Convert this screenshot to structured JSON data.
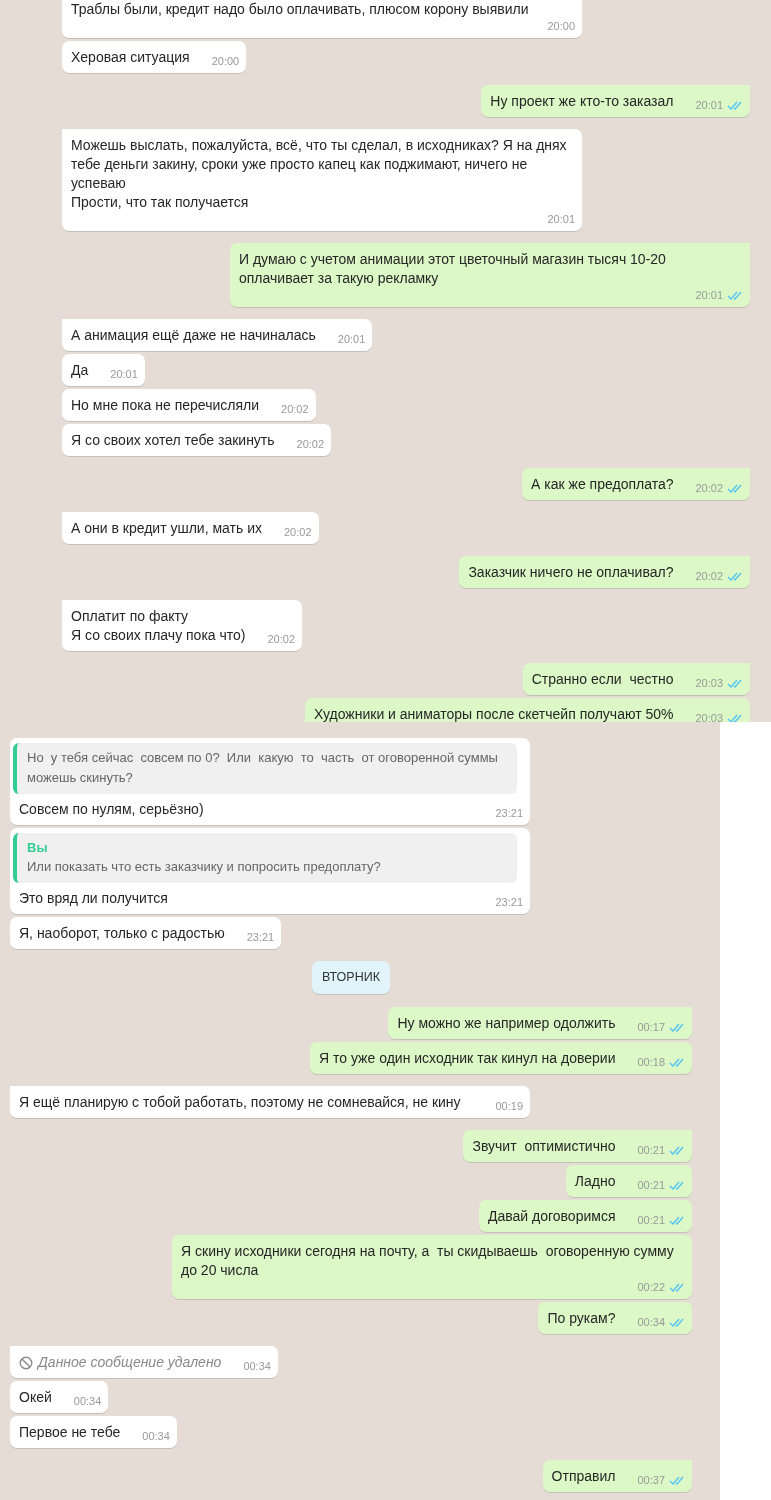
{
  "panels": [
    {
      "messages": [
        {
          "kind": "incoming",
          "text": "Траблы были, кредит надо было оплачивать, плюсом корону выявили",
          "time": "20:00",
          "tail": false
        },
        {
          "kind": "incoming",
          "text": "Херовая ситуация",
          "time": "20:00",
          "tail": false
        },
        {
          "kind": "outgoing",
          "text": "Ну проект же кто-то заказал",
          "time": "20:01",
          "read": true,
          "tail": true
        },
        {
          "kind": "incoming",
          "text": "Можешь выслать, пожалуйста, всё, что ты сделал, в исходниках? Я на днях тебе деньги закину, сроки уже просто капец как поджимают, ничего не успеваю\nПрости, что так получается",
          "time": "20:01",
          "tail": true
        },
        {
          "kind": "outgoing",
          "text": "И думаю с учетом анимации этот цветочный магазин тысяч 10-20 оплачивает за такую рекламку",
          "time": "20:01",
          "read": true,
          "tail": true
        },
        {
          "kind": "incoming",
          "text": "А анимация ещё даже не начиналась",
          "time": "20:01",
          "tail": true
        },
        {
          "kind": "incoming",
          "text": "Да",
          "time": "20:01",
          "tail": false
        },
        {
          "kind": "incoming",
          "text": "Но мне пока не перечисляли",
          "time": "20:02",
          "tail": false
        },
        {
          "kind": "incoming",
          "text": "Я со своих хотел тебе закинуть",
          "time": "20:02",
          "tail": false
        },
        {
          "kind": "outgoing",
          "text": "А как же предоплата?",
          "time": "20:02",
          "read": true,
          "tail": true
        },
        {
          "kind": "incoming",
          "text": "А они в кредит ушли, мать их",
          "time": "20:02",
          "tail": true
        },
        {
          "kind": "outgoing",
          "text": "Заказчик ничего не оплачивал?",
          "time": "20:02",
          "read": true,
          "tail": true
        },
        {
          "kind": "incoming",
          "text": "Оплатит по факту\nЯ со своих плачу пока что)",
          "time": "20:02",
          "tail": true
        },
        {
          "kind": "outgoing",
          "text": "Странно если  честно",
          "time": "20:03",
          "read": true,
          "tail": true
        },
        {
          "kind": "outgoing",
          "text": "Художники и аниматоры после скетчейп получают 50%",
          "time": "20:03",
          "read": true,
          "tail": false
        }
      ]
    },
    {
      "messages": [
        {
          "kind": "incoming",
          "quote": {
            "text": "Но  у тебя сейчас  совсем по 0?  Или  какую  то  часть  от оговоренной суммы можешь скинуть?"
          },
          "text": "Совсем по нулям, серьёзно)",
          "time": "23:21",
          "tail": false
        },
        {
          "kind": "incoming",
          "quote": {
            "author": "Вы",
            "text": "Или показать что есть заказчику и попросить предоплату?"
          },
          "text": "Это вряд ли получится",
          "time": "23:21",
          "tail": false
        },
        {
          "kind": "incoming",
          "text": "Я, наоборот, только с радостью",
          "time": "23:21",
          "tail": false
        },
        {
          "kind": "day",
          "text": "ВТОРНИК"
        },
        {
          "kind": "outgoing",
          "text": "Ну можно же например одолжить",
          "time": "00:17",
          "read": true,
          "tail": true
        },
        {
          "kind": "outgoing",
          "text": "Я то уже один исходник так кинул на доверии",
          "time": "00:18",
          "read": true,
          "tail": false
        },
        {
          "kind": "incoming",
          "text": "Я ещё планирую с тобой работать, поэтому не сомневайся, не кину",
          "time": "00:19",
          "tail": true,
          "wide": true
        },
        {
          "kind": "outgoing",
          "text": "Звучит  оптимистично",
          "time": "00:21",
          "read": true,
          "tail": true
        },
        {
          "kind": "outgoing",
          "text": "Ладно",
          "time": "00:21",
          "read": true,
          "tail": false
        },
        {
          "kind": "outgoing",
          "text": "Давай договоримся",
          "time": "00:21",
          "read": true,
          "tail": false
        },
        {
          "kind": "outgoing",
          "text": "Я скину исходники сегодня на почту, а  ты скидываешь  оговоренную сумму до 20 числа",
          "time": "00:22",
          "read": true,
          "tail": false
        },
        {
          "kind": "outgoing",
          "text": "По рукам?",
          "time": "00:34",
          "read": true,
          "tail": false
        },
        {
          "kind": "deleted",
          "text": "Данное сообщение удалено",
          "time": "00:34",
          "tail": true
        },
        {
          "kind": "incoming",
          "text": "Окей",
          "time": "00:34",
          "tail": false
        },
        {
          "kind": "incoming",
          "text": "Первое не тебе",
          "time": "00:34",
          "tail": false
        },
        {
          "kind": "outgoing",
          "text": "Отправил",
          "time": "00:37",
          "read": true,
          "tail": true
        }
      ]
    }
  ]
}
